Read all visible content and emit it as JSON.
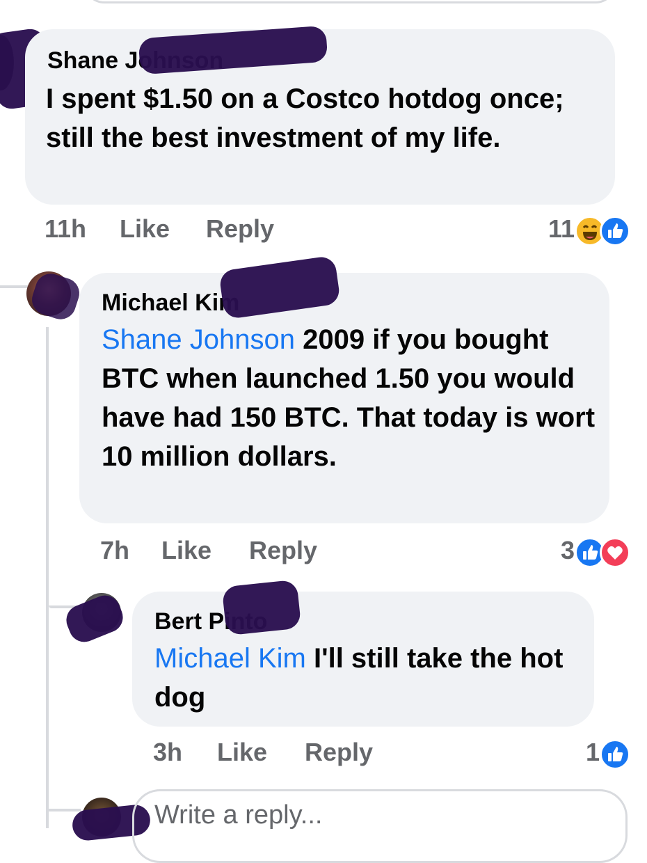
{
  "comments": [
    {
      "author": "Shane Johnson",
      "text": "I spent $1.50 on a Costco hotdog once; still the best investment of my life.",
      "time": "11h",
      "like_label": "Like",
      "reply_label": "Reply",
      "reaction_count": "11",
      "reactions": [
        "haha-icon",
        "like-icon"
      ]
    },
    {
      "author": "Michael Kim",
      "mention": "Shane Johnson",
      "text": " 2009 if you bought BTC when launched 1.50 you would have had 150 BTC. That today is wort 10 million dollars.",
      "time": "7h",
      "like_label": "Like",
      "reply_label": "Reply",
      "reaction_count": "3",
      "reactions": [
        "like-icon",
        "love-icon"
      ]
    },
    {
      "author": "Bert Pinto",
      "mention": "Michael Kim",
      "text": " I'll still take the hot dog",
      "time": "3h",
      "like_label": "Like",
      "reply_label": "Reply",
      "reaction_count": "1",
      "reactions": [
        "like-icon"
      ]
    }
  ],
  "reply_input": {
    "placeholder": "Write a reply..."
  },
  "colors": {
    "bubble": "#f0f2f5",
    "mention": "#1877f2",
    "meta": "#65676b",
    "like": "#1877f2",
    "love": "#f33e58",
    "haha": "#f7b928",
    "redaction": "#2a0f4f"
  }
}
